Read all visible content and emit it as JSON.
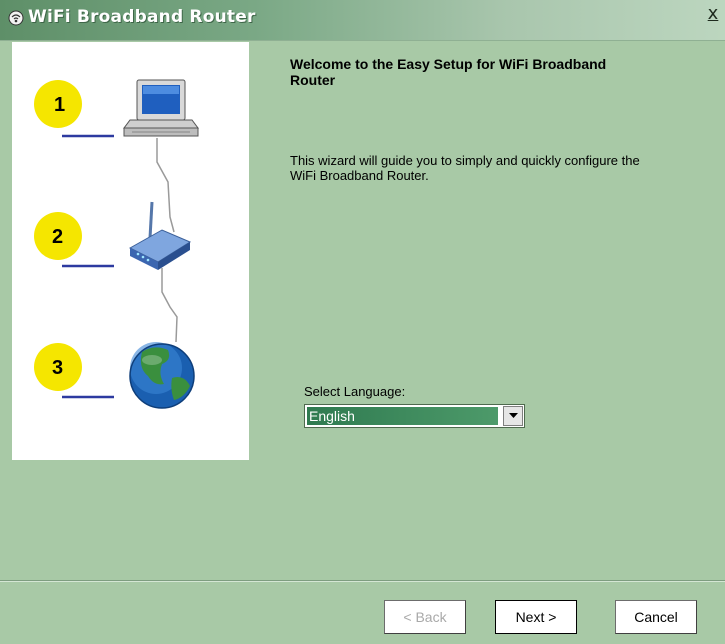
{
  "window": {
    "title": "WiFi Broadband Router",
    "close_label": "x"
  },
  "side_panel": {
    "steps": [
      {
        "number": "1",
        "device": "computer"
      },
      {
        "number": "2",
        "device": "router"
      },
      {
        "number": "3",
        "device": "globe"
      }
    ],
    "badge_color": "#f5e600"
  },
  "main": {
    "heading": "Welcome to the Easy Setup for WiFi Broadband Router",
    "description": "This wizard will guide you to simply and quickly configure the WiFi Broadband Router.",
    "language_label": "Select Language:",
    "language_value": "English"
  },
  "buttons": {
    "back": "< Back",
    "next": "Next >",
    "cancel": "Cancel"
  },
  "colors": {
    "background": "#a8c9a6",
    "selection": "#2f7a50"
  }
}
